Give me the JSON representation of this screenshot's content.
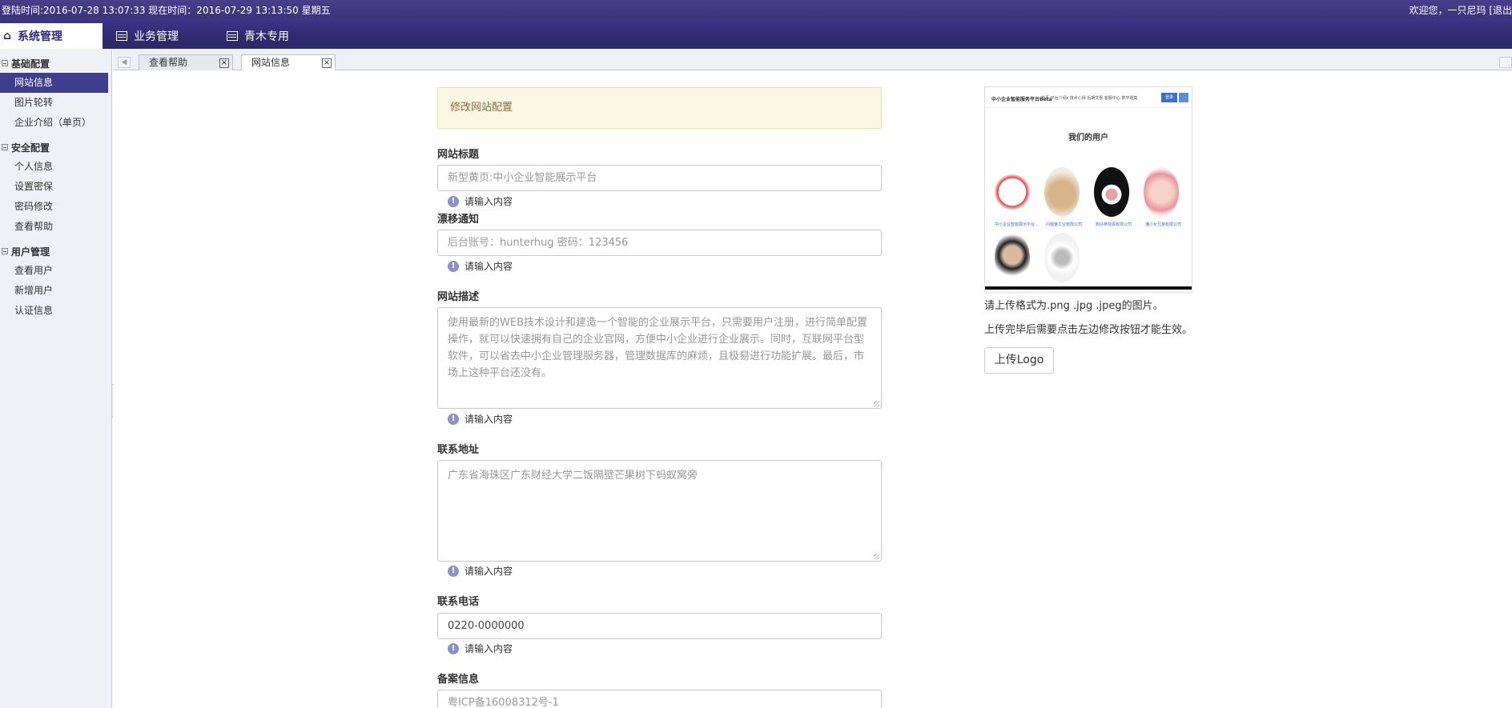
{
  "topbar": {
    "login_info": "登陆时间:2016-07-28 13:07:33 现在时间：2016-07-29 13:13:50 星期五",
    "welcome": "欢迎您，一只尼玛  [退出"
  },
  "nav": {
    "active_label": "系统管理",
    "tabs": [
      {
        "label": "业务管理",
        "icon": "list-icon"
      },
      {
        "label": "青木专用",
        "icon": "list-icon"
      }
    ]
  },
  "sidebar": {
    "groups": [
      {
        "title": "基础配置",
        "items": [
          "网站信息",
          "图片轮转",
          "企业介绍（单页）"
        ]
      },
      {
        "title": "安全配置",
        "items": [
          "个人信息",
          "设置密保",
          "密码修改",
          "查看帮助"
        ]
      },
      {
        "title": "用户管理",
        "items": [
          "查看用户",
          "新增用户",
          "认证信息"
        ]
      }
    ],
    "active_item": "网站信息"
  },
  "page_tabs": [
    {
      "label": "查看帮助",
      "active": false
    },
    {
      "label": "网站信息",
      "active": true
    }
  ],
  "form": {
    "notice": "修改网站配置",
    "site_title_label": "网站标题",
    "site_title_placeholder": "新型黄页:中小企业智能展示平台",
    "hint": "请输入内容",
    "notice_label": "漂移通知",
    "notice_placeholder": "后台账号：hunterhug 密码：123456",
    "desc_label": "网站描述",
    "desc_placeholder": "使用最新的WEB技术设计和建造一个智能的企业展示平台，只需要用户注册，进行简单配置操作，就可以快速拥有自己的企业官网，方便中小企业进行企业展示。同时，互联网平台型软件，可以省去中小企业管理服务器，管理数据库的麻烦，且极易进行功能扩展。最后，市场上这种平台还没有。",
    "address_label": "联系地址",
    "address_placeholder": "广东省海珠区广东财经大学二饭隔壁芒果树下蚂蚁窝旁",
    "phone_label": "联系电话",
    "phone_value": "0220-0000000",
    "icp_label": "备案信息",
    "icp_placeholder": "粤ICP备16008312号-1"
  },
  "logo": {
    "preview": {
      "brand": "中小企业智能服务平台Beta",
      "links": "首页  平台介绍▾  技术心得  后期优惠  客服中心  数学题集",
      "button": "登录",
      "title": "我们的用户",
      "captions": [
        "中小企业智能展示平台...",
        "问题整工业有限公司",
        "狗仔参观源有限公司",
        "潘小女兄弟有限公司"
      ]
    },
    "format_text": "请上传格式为.png .jpg .jpeg的图片。",
    "after_text": "上传完毕后需要点击左边修改按钮才能生效。",
    "upload_label": "上传Logo"
  }
}
